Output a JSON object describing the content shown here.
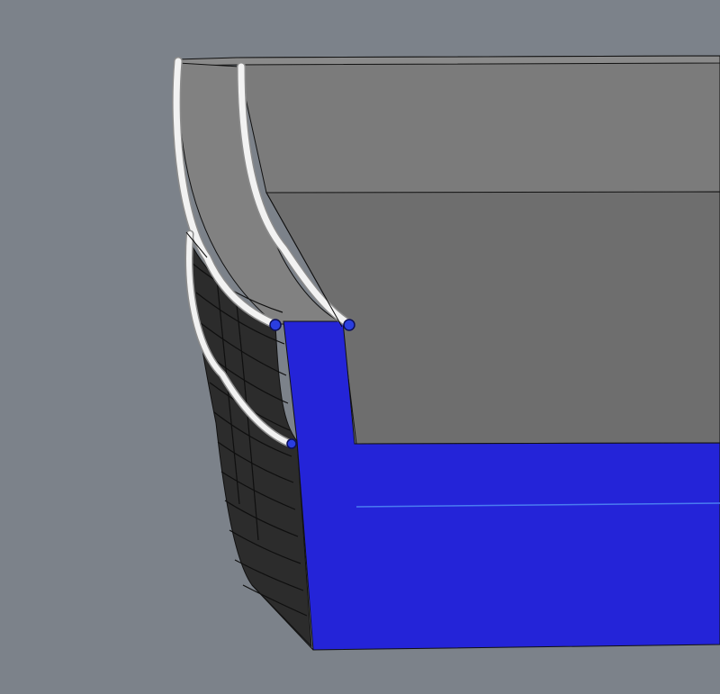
{
  "viewport": {
    "background_color": "#7c828a"
  },
  "model": {
    "wall_top_color": "#7b7b7b",
    "inner_floor_color": "#6e6e6e",
    "far_edge_color": "#838383",
    "rim_color": "#8a8a8a",
    "planks_color": "#2c2c2c",
    "plank_line_color": "#141414",
    "section_color": "#2424d8",
    "section_seam_color": "#4a7cf0",
    "frame_color": "#f2f2f2",
    "frame_shadow_color": "#8c8c8c",
    "node_color": "#2a3ee0",
    "node_outline_color": "#0b0f5a",
    "outline_color": "#111111"
  },
  "icons": {
    "frame": "curved-frame-icon",
    "node": "selected-node-icon"
  }
}
